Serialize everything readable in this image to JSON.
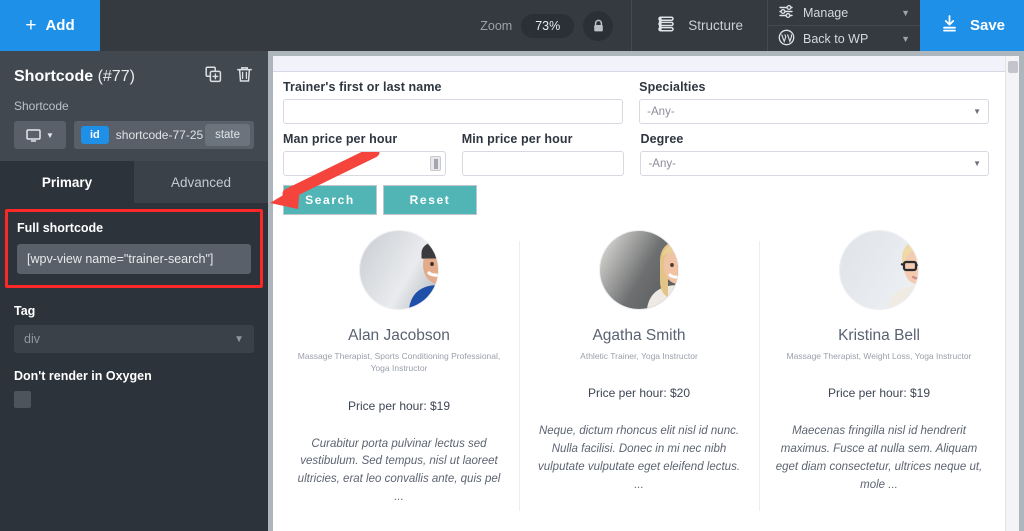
{
  "topbar": {
    "add_label": "Add",
    "add_icon": "plus-icon",
    "zoom_label": "Zoom",
    "zoom_value": "73%",
    "lock_icon": "lock-icon",
    "structure_label": "Structure",
    "structure_icon": "layers-icon",
    "manage_label": "Manage",
    "manage_icon": "sliders-icon",
    "back_to_wp_label": "Back to WP",
    "wordpress_icon": "wordpress-icon",
    "save_label": "Save",
    "save_icon": "download-icon",
    "accent_blue": "#1e90e8",
    "bar_bg": "#343a40"
  },
  "left_panel": {
    "title": "Shortcode",
    "title_id": "(#77)",
    "duplicate_icon": "duplicate-icon",
    "delete_icon": "trash-icon",
    "section_label": "Shortcode",
    "device_icon": "monitor-icon",
    "device_caret": "chevron-down-icon",
    "id_pill": "id",
    "id_value": "shortcode-77-25",
    "state_label": "state",
    "tabs": [
      {
        "label": "Primary",
        "active": true
      },
      {
        "label": "Advanced",
        "active": false
      }
    ],
    "full_shortcode_label": "Full shortcode",
    "full_shortcode_value": "[wpv-view name=\"trainer-search\"]",
    "highlight_color": "#fc2828",
    "tag_label": "Tag",
    "tag_value": "div",
    "dont_render_label": "Don't render in Oxygen",
    "dont_render_checked": false
  },
  "canvas": {
    "form": {
      "fields": [
        {
          "label": "Trainer's first or last name",
          "type": "text",
          "value": ""
        },
        {
          "label": "Specialties",
          "type": "select",
          "value": "-Any-"
        },
        {
          "label": "Man price per hour",
          "type": "number",
          "value": ""
        },
        {
          "label": "Min price per hour",
          "type": "text",
          "value": ""
        },
        {
          "label": "Degree",
          "type": "select",
          "value": "-Any-"
        }
      ],
      "search_label": "Search",
      "reset_label": "Reset",
      "button_color": "#52b5b5"
    },
    "trainers": [
      {
        "avatar": "avatar-man-beanie",
        "name": "Alan Jacobson",
        "specialties": "Massage Therapist, Sports Conditioning Professional, Yoga Instructor",
        "price": "Price per hour: $19",
        "bio": "Curabitur porta pulvinar lectus sed vestibulum. Sed tempus, nisl ut laoreet ultricies, erat leo convallis ante, quis pel ..."
      },
      {
        "avatar": "avatar-blonde-woman",
        "name": "Agatha Smith",
        "specialties": "Athletic Trainer, Yoga Instructor",
        "price": "Price per hour: $20",
        "bio": "Neque, dictum rhoncus elit nisl id nunc. Nulla facilisi. Donec in mi nec nibh vulputate vulputate eget eleifend lectus. ..."
      },
      {
        "avatar": "avatar-woman-glasses",
        "name": "Kristina Bell",
        "specialties": "Massage Therapist, Weight Loss, Yoga Instructor",
        "price": "Price per hour: $19",
        "bio": "Maecenas fringilla nisl id hendrerit maximus. Fusce at nulla sem. Aliquam eget diam consectetur, ultrices neque ut, mole ..."
      }
    ],
    "scrollbar_icon": "scroll-thumb"
  }
}
